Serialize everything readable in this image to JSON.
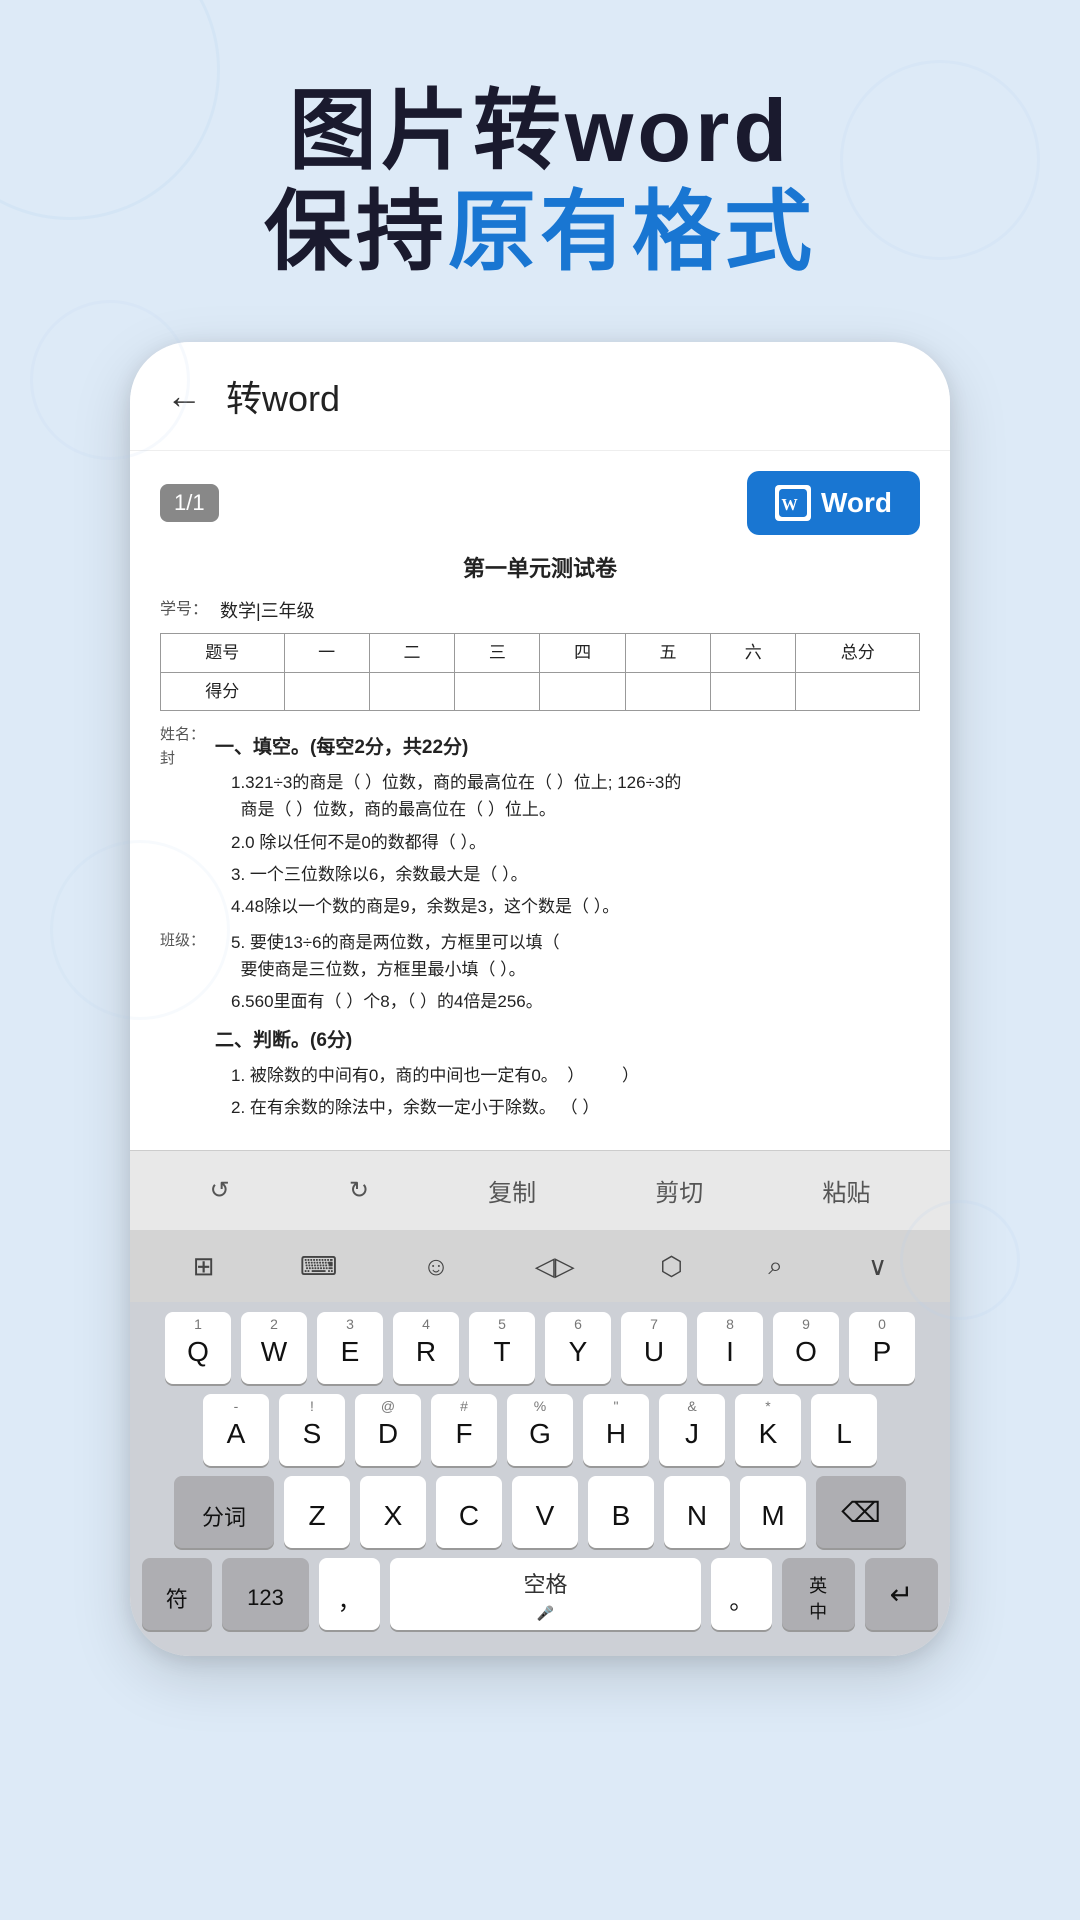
{
  "hero": {
    "line1": "图片转word",
    "line2_prefix": "保持",
    "line2_blue": "原有格式",
    "line2_suffix": ""
  },
  "topbar": {
    "back": "←",
    "title": "转word"
  },
  "doc": {
    "page_badge": "1/1",
    "word_button": "Word",
    "title": "第一单元测试卷",
    "info_xue": "学号：",
    "info_xue_val": "数学|三年级",
    "table": {
      "headers": [
        "题号",
        "一",
        "二",
        "三",
        "四",
        "五",
        "六",
        "总分"
      ],
      "row2": [
        "得分",
        "",
        "",
        "",
        "",
        "",
        "",
        ""
      ]
    },
    "section1": "一、填空。(每空2分，共22分)",
    "items": [
      "1.321÷3的商是（ ）位数，商的最高位在（ ）位上; 126÷3的\n      商是（ ）位数，商的最高位在（ ）位上。",
      "2.0 除以任何不是0的数都得（ ）。",
      "3. 一个三位数除以6，余数最大是（ ）。",
      "4.48除以一个数的商是9，余数是3，这个数是（ ）。",
      "5. 要使13÷6的商是两位数，方框里可以填（\n      要使商是三位数，方框里最小填（ ）。",
      "6.560里面有（ ）个8，（ ）的4倍是256。"
    ],
    "section2": "二、判断。(6分)",
    "judge_items": [
      "1. 被除数的中间有0，商的中间也一定有0。    ）          ）",
      "2. 在有余数的除法中，余数一定小于除数。  （ ）"
    ],
    "side_labels": {
      "name_label": "姓名：\n封",
      "class_label": "班级："
    }
  },
  "keyboard_toolbar": {
    "undo": "↺",
    "redo": "↻",
    "copy": "复制",
    "cut": "剪切",
    "paste": "粘贴"
  },
  "keyboard_icons": {
    "grid": "⊞",
    "keys": "⌨",
    "emoji": "☺",
    "cursor": "◁▷",
    "link": "⬡",
    "search": "⌕",
    "collapse": "∨"
  },
  "keyboard": {
    "row1": [
      {
        "sub": "1",
        "main": "Q"
      },
      {
        "sub": "2",
        "main": "W"
      },
      {
        "sub": "3",
        "main": "E"
      },
      {
        "sub": "4",
        "main": "R"
      },
      {
        "sub": "5",
        "main": "T"
      },
      {
        "sub": "6",
        "main": "Y"
      },
      {
        "sub": "7",
        "main": "U"
      },
      {
        "sub": "8",
        "main": "I"
      },
      {
        "sub": "9",
        "main": "O"
      },
      {
        "sub": "0",
        "main": "P"
      }
    ],
    "row2": [
      {
        "sub": "-",
        "main": "A"
      },
      {
        "sub": "!",
        "main": "S"
      },
      {
        "sub": "@",
        "main": "D"
      },
      {
        "sub": "#",
        "main": "F"
      },
      {
        "sub": "%",
        "main": "G"
      },
      {
        "sub": "\"",
        "main": "H"
      },
      {
        "sub": "&",
        "main": "J"
      },
      {
        "sub": "*",
        "main": "K"
      },
      {
        "sub": "",
        "main": "L"
      }
    ],
    "row3_special_left": "分词",
    "row3": [
      {
        "sub": "",
        "main": "Z"
      },
      {
        "sub": "",
        "main": "X"
      },
      {
        "sub": "",
        "main": "C"
      },
      {
        "sub": "",
        "main": "V"
      },
      {
        "sub": "",
        "main": "B"
      },
      {
        "sub": "",
        "main": "N"
      },
      {
        "sub": "",
        "main": "M"
      }
    ],
    "row3_delete": "⌫",
    "row4_special": "符",
    "row4_123": "123",
    "row4_comma": "，",
    "row4_space": "空格",
    "row4_period": "。",
    "row4_en": "英\n中",
    "row4_return": "↵"
  }
}
